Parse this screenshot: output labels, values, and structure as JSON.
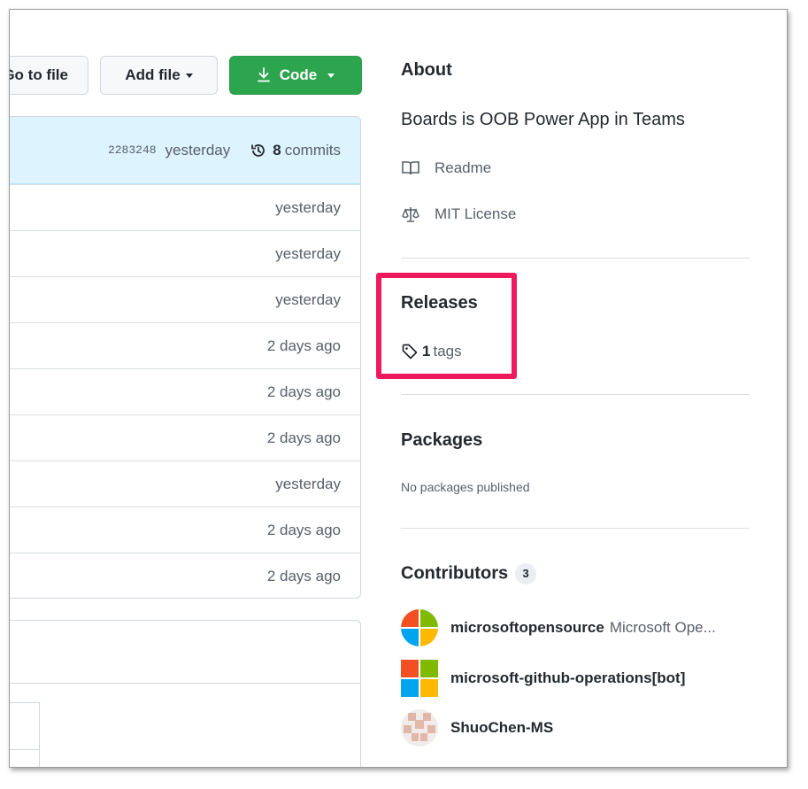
{
  "toolbar": {
    "goto_label": "Go to file",
    "add_file_label": "Add file",
    "code_label": "Code",
    "accent_color": "#2da44e"
  },
  "commit_bar": {
    "hash": "2283248",
    "time": "yesterday",
    "count": "8",
    "count_label": "commits"
  },
  "file_rows": [
    {
      "time": "yesterday"
    },
    {
      "time": "yesterday"
    },
    {
      "time": "yesterday"
    },
    {
      "time": "2 days ago"
    },
    {
      "time": "2 days ago"
    },
    {
      "time": "2 days ago"
    },
    {
      "time": "yesterday"
    },
    {
      "time": "2 days ago"
    },
    {
      "time": "2 days ago"
    }
  ],
  "about": {
    "title": "About",
    "description": "Boards is OOB Power App in Teams",
    "readme_label": "Readme",
    "license_label": "MIT License"
  },
  "releases": {
    "title": "Releases",
    "tag_count": "1",
    "tag_label": "tags",
    "highlight_color": "#f0195e"
  },
  "packages": {
    "title": "Packages",
    "empty_text": "No packages published"
  },
  "contributors": {
    "title": "Contributors",
    "count": "3",
    "items": [
      {
        "login": "microsoftopensource",
        "name": "Microsoft Ope...",
        "avatar": "microsoft-logo-rounded"
      },
      {
        "login": "microsoft-github-operations[bot]",
        "name": "",
        "avatar": "microsoft-logo-square"
      },
      {
        "login": "ShuoChen-MS",
        "name": "",
        "avatar": "identicon"
      }
    ]
  }
}
